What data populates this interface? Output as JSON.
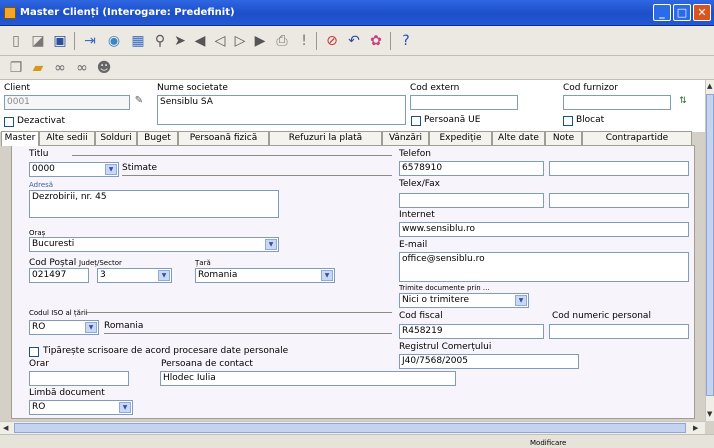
{
  "window": {
    "title": "Master Clienți (Interogare: Predefinit)",
    "min": "_",
    "max": "□",
    "close": "✕"
  },
  "toolbar1": [
    "new-doc-icon",
    "edit-doc-icon",
    "save-icon",
    "import-icon",
    "globe-icon",
    "preview-icon",
    "find-icon",
    "flag-icon",
    "nav-first-icon",
    "nav-prev-icon",
    "nav-next-icon",
    "nav-last-icon",
    "print-icon",
    "alert-icon",
    "delete-icon",
    "undo-icon",
    "filter-icon",
    "help-icon"
  ],
  "toolbar2": [
    "copy-icon",
    "open-folder-icon",
    "binoculars-icon",
    "binoculars-all-icon",
    "user-icon"
  ],
  "header": {
    "client_label": "Client",
    "client_value": "0001",
    "societate_label": "Nume societate",
    "societate_value": "Sensiblu SA",
    "cod_extern_label": "Cod extern",
    "cod_extern_value": "",
    "cod_furnizor_label": "Cod furnizor",
    "cod_furnizor_value": "",
    "dezactivat_label": "Dezactivat",
    "persoana_ue_label": "Persoană UE",
    "blocat_label": "Blocat"
  },
  "tabs": [
    "Master",
    "Alte sedii",
    "Solduri",
    "Buget",
    "Persoană fizică",
    "Refuzuri la plată",
    "Vânzări",
    "Expediție",
    "Alte date",
    "Note",
    "Contrapartide"
  ],
  "master": {
    "titlu_label": "Titlu",
    "titlu_value": "0000",
    "titlu_text": "Stimate",
    "adresa_label": "Adresă",
    "adresa_value": "Dezrobirii, nr. 45",
    "oras_label": "Oraș",
    "oras_value": "Bucuresti",
    "cod_postal_label": "Cod Poștal",
    "cod_postal_value": "021497",
    "judet_label": "Județ/Sector",
    "judet_value": "3",
    "tara_label": "Țară",
    "tara_value": "Romania",
    "iso_label": "Codul ISO al țării",
    "iso_value": "RO",
    "iso_text": "Romania",
    "tipareste_label": "Tipărește scrisoare de acord procesare date personale",
    "orar_label": "Orar",
    "orar_value": "",
    "contact_label": "Persoana de contact",
    "contact_value": "Hlodec Iulia",
    "limba_label": "Limbă document",
    "limba_value": "RO",
    "telefon_label": "Telefon",
    "telefon_value": "6578910",
    "telefon2_value": "",
    "telex_label": "Telex/Fax",
    "telex_value": "",
    "telex2_value": "",
    "internet_label": "Internet",
    "internet_value": "www.sensiblu.ro",
    "email_label": "E-mail",
    "email_value": "office@sensiblu.ro",
    "trimite_label": "Trimite documente prin ...",
    "trimite_value": "Nici o trimitere",
    "cod_fiscal_label": "Cod fiscal",
    "cod_fiscal_value": "R458219",
    "cnp_label": "Cod numeric personal",
    "cnp_value": "",
    "registru_label": "Registrul Comerțului",
    "registru_value": "J40/7568/2005"
  },
  "status": {
    "mode": "Modificare"
  }
}
